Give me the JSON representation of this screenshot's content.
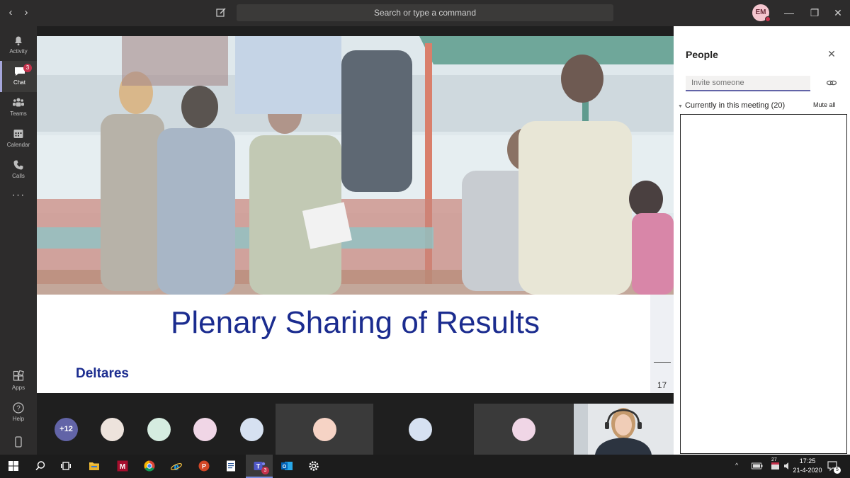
{
  "titlebar": {
    "search_placeholder": "Search or type a command",
    "avatar_initials": "EM"
  },
  "rail": {
    "items": [
      {
        "label": "Activity",
        "icon": "bell-icon"
      },
      {
        "label": "Chat",
        "icon": "chat-icon",
        "badge": "3"
      },
      {
        "label": "Teams",
        "icon": "teams-icon"
      },
      {
        "label": "Calendar",
        "icon": "calendar-icon"
      },
      {
        "label": "Calls",
        "icon": "phone-icon"
      },
      {
        "label": "Apps",
        "icon": "apps-icon"
      },
      {
        "label": "Help",
        "icon": "help-icon"
      }
    ]
  },
  "slide": {
    "title": "Plenary Sharing of Results",
    "logo": "Deltares",
    "page_number": "17"
  },
  "gallery": {
    "overflow_label": "+12",
    "avatar_colors": [
      "#ede3dc",
      "#d5ece0",
      "#f0d6e6",
      "#d6e1f1",
      "#f6d3c5",
      "#d6e1f1",
      "#f0d6e6"
    ]
  },
  "panel": {
    "title": "People",
    "invite_placeholder": "Invite someone",
    "section_label": "Currently in this meeting (20)",
    "mute_all": "Mute all"
  },
  "taskbar": {
    "teams_badge": "3",
    "calendar_badge": "27",
    "notification_count": "5",
    "time": "17:25",
    "date": "21-4-2020"
  },
  "colors": {
    "accent": "#6264a7",
    "slide_blue": "#1b2c8f",
    "badge_red": "#c4314b"
  }
}
